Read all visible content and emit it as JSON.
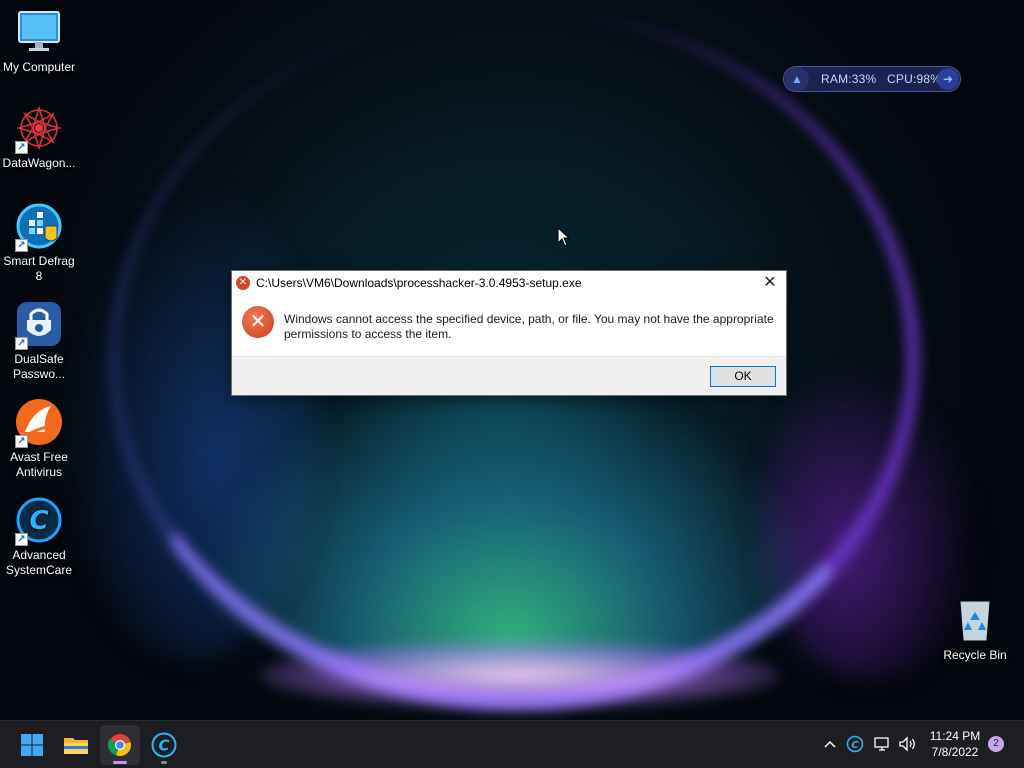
{
  "desktop": {
    "icons": [
      {
        "label": "My Computer",
        "icon": "monitor-icon"
      },
      {
        "label": "DataWagon...",
        "icon": "datawagon-icon"
      },
      {
        "label": "Smart Defrag 8",
        "icon": "smart-defrag-icon"
      },
      {
        "label": "DualSafe Passwo...",
        "icon": "dualsafe-icon"
      },
      {
        "label": "Avast Free Antivirus",
        "icon": "avast-icon"
      },
      {
        "label": "Advanced SystemCare",
        "icon": "advanced-systemcare-icon"
      }
    ],
    "recycle_bin": {
      "label": "Recycle Bin",
      "icon": "recycle-bin-icon"
    }
  },
  "perf_widget": {
    "ram": "RAM:33%",
    "cpu": "CPU:98%"
  },
  "dialog": {
    "title": "C:\\Users\\VM6\\Downloads\\processhacker-3.0.4953-setup.exe",
    "message": "Windows cannot access the specified device, path, or file. You may not have the appropriate permissions to access the item.",
    "ok_label": "OK"
  },
  "taskbar": {
    "apps": [
      {
        "name": "start-button",
        "icon": "windows-logo-icon"
      },
      {
        "name": "file-explorer",
        "icon": "folder-icon"
      },
      {
        "name": "chrome",
        "icon": "chrome-icon"
      },
      {
        "name": "advanced-systemcare",
        "icon": "advanced-systemcare-icon"
      }
    ],
    "time": "11:24 PM",
    "date": "7/8/2022",
    "notification_count": "2"
  },
  "colors": {
    "accent": "#0078d7",
    "error": "#d2492a",
    "taskbar_bg": "#1c1e22"
  }
}
